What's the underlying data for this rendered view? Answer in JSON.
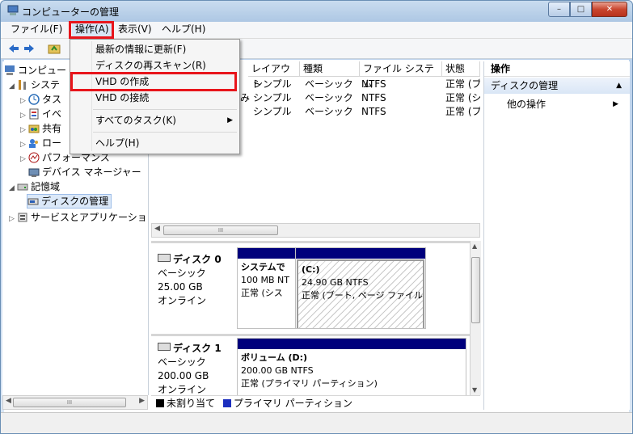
{
  "window": {
    "title": "コンピューターの管理",
    "minimize": "–",
    "maximize": "□",
    "close": "✕"
  },
  "menubar": {
    "items": [
      "ファイル(F)",
      "操作(A)",
      "表示(V)",
      "ヘルプ(H)"
    ]
  },
  "operation_menu": {
    "items": [
      "最新の情報に更新(F)",
      "ディスクの再スキャン(R)",
      "VHD の作成",
      "VHD の接続",
      "すべてのタスク(K)",
      "ヘルプ(H)"
    ],
    "highlighted_item": "VHD の作成",
    "submenu_arrow": "▶"
  },
  "tree": {
    "root": "コンピュー",
    "system": "システ",
    "task": "タス",
    "event": "イベ",
    "shared": "共有",
    "local": "ロー",
    "performance": "パフォーマンス",
    "device_manager": "デバイス マネージャー",
    "storage": "記憶域",
    "disk_management": "ディスクの管理",
    "services": "サービスとアプリケーショ",
    "scroll_label": "III"
  },
  "volume_list": {
    "headers": [
      "レイアウト",
      "種類",
      "ファイル システム",
      "状態"
    ],
    "rows": [
      {
        "prefix": "",
        "layout": "シンプル",
        "type": "ベーシック",
        "fs": "NTFS",
        "status": "正常 (ブ"
      },
      {
        "prefix": "み",
        "layout": "シンプル",
        "type": "ベーシック",
        "fs": "NTFS",
        "status": "正常 (シ"
      },
      {
        "prefix": "",
        "layout": "シンプル",
        "type": "ベーシック",
        "fs": "NTFS",
        "status": "正常 (プ"
      }
    ],
    "scroll_label": "III"
  },
  "disks": [
    {
      "name": "ディスク 0",
      "type": "ベーシック",
      "size": "25.00 GB",
      "state": "オンライン",
      "partitions": [
        {
          "title": "システムで",
          "size": "100 MB NT",
          "status": "正常 (シス"
        },
        {
          "title": "(C:)",
          "size": "24.90 GB NTFS",
          "status": "正常 (ブート, ページ ファイル"
        }
      ]
    },
    {
      "name": "ディスク 1",
      "type": "ベーシック",
      "size": "200.00 GB",
      "state": "オンライン",
      "partitions": [
        {
          "title": "ボリューム (D:)",
          "size": "200.00 GB NTFS",
          "status": "正常 (プライマリ パーティション)"
        }
      ]
    }
  ],
  "legend": {
    "unallocated": "未割り当て",
    "primary": "プライマリ パーティション"
  },
  "actions": {
    "header": "操作",
    "section": "ディスクの管理",
    "other": "他の操作"
  },
  "colors": {
    "partition_bar": "#00007c",
    "highlight_box": "#e8151b",
    "unallocated": "#000000",
    "primary": "#1c2fbf"
  }
}
